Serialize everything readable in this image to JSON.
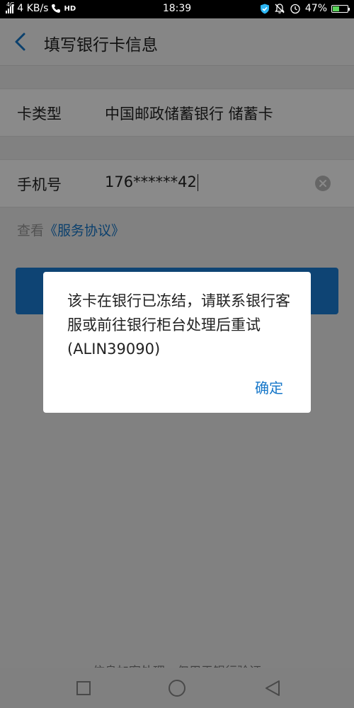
{
  "status_bar": {
    "network": "4G",
    "speed": "4 KB/s",
    "hd": "HD",
    "time": "18:39",
    "battery": "47%",
    "battery_level": 0.47
  },
  "header": {
    "title": "填写银行卡信息",
    "back_icon": "chevron-left-icon"
  },
  "form": {
    "card_type": {
      "label": "卡类型",
      "value": "中国邮政储蓄银行 储蓄卡"
    },
    "phone": {
      "label": "手机号",
      "value": "176******42"
    }
  },
  "agreement": {
    "prefix": "查看",
    "link": "《服务协议》"
  },
  "footer": {
    "note": "信息加密处理，仅用于银行验证"
  },
  "dialog": {
    "message": "该卡在银行已冻结，请联系银行客服或前往银行柜台处理后重试(ALIN39090)",
    "confirm_label": "确定"
  },
  "colors": {
    "accent": "#1677c9",
    "button": "#1b7fd6",
    "overlay": "rgba(0,0,0,0.46)"
  }
}
